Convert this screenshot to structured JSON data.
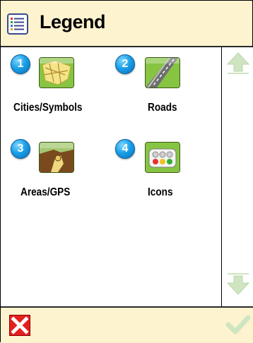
{
  "header": {
    "title": "Legend",
    "icon": "legend-list-icon"
  },
  "items": [
    {
      "number": "1",
      "label": "Cities/Symbols",
      "icon": "city-map-icon"
    },
    {
      "number": "2",
      "label": "Roads",
      "icon": "road-icon"
    },
    {
      "number": "3",
      "label": "Areas/GPS",
      "icon": "area-icon"
    },
    {
      "number": "4",
      "label": "Icons",
      "icon": "traffic-lights-icon"
    }
  ],
  "scroll": {
    "up_icon": "scroll-up-arrow-icon",
    "down_icon": "scroll-down-arrow-icon",
    "up_enabled": false,
    "down_enabled": false
  },
  "footer": {
    "close_icon": "close-x-icon",
    "ok_icon": "checkmark-icon",
    "ok_enabled": false
  },
  "colors": {
    "header_bg": "#fdf3cf",
    "badge": "#1aa0e8",
    "close": "#e51f1f",
    "tile_green": "#7cc03c",
    "disabled": "#cfe5c2"
  }
}
